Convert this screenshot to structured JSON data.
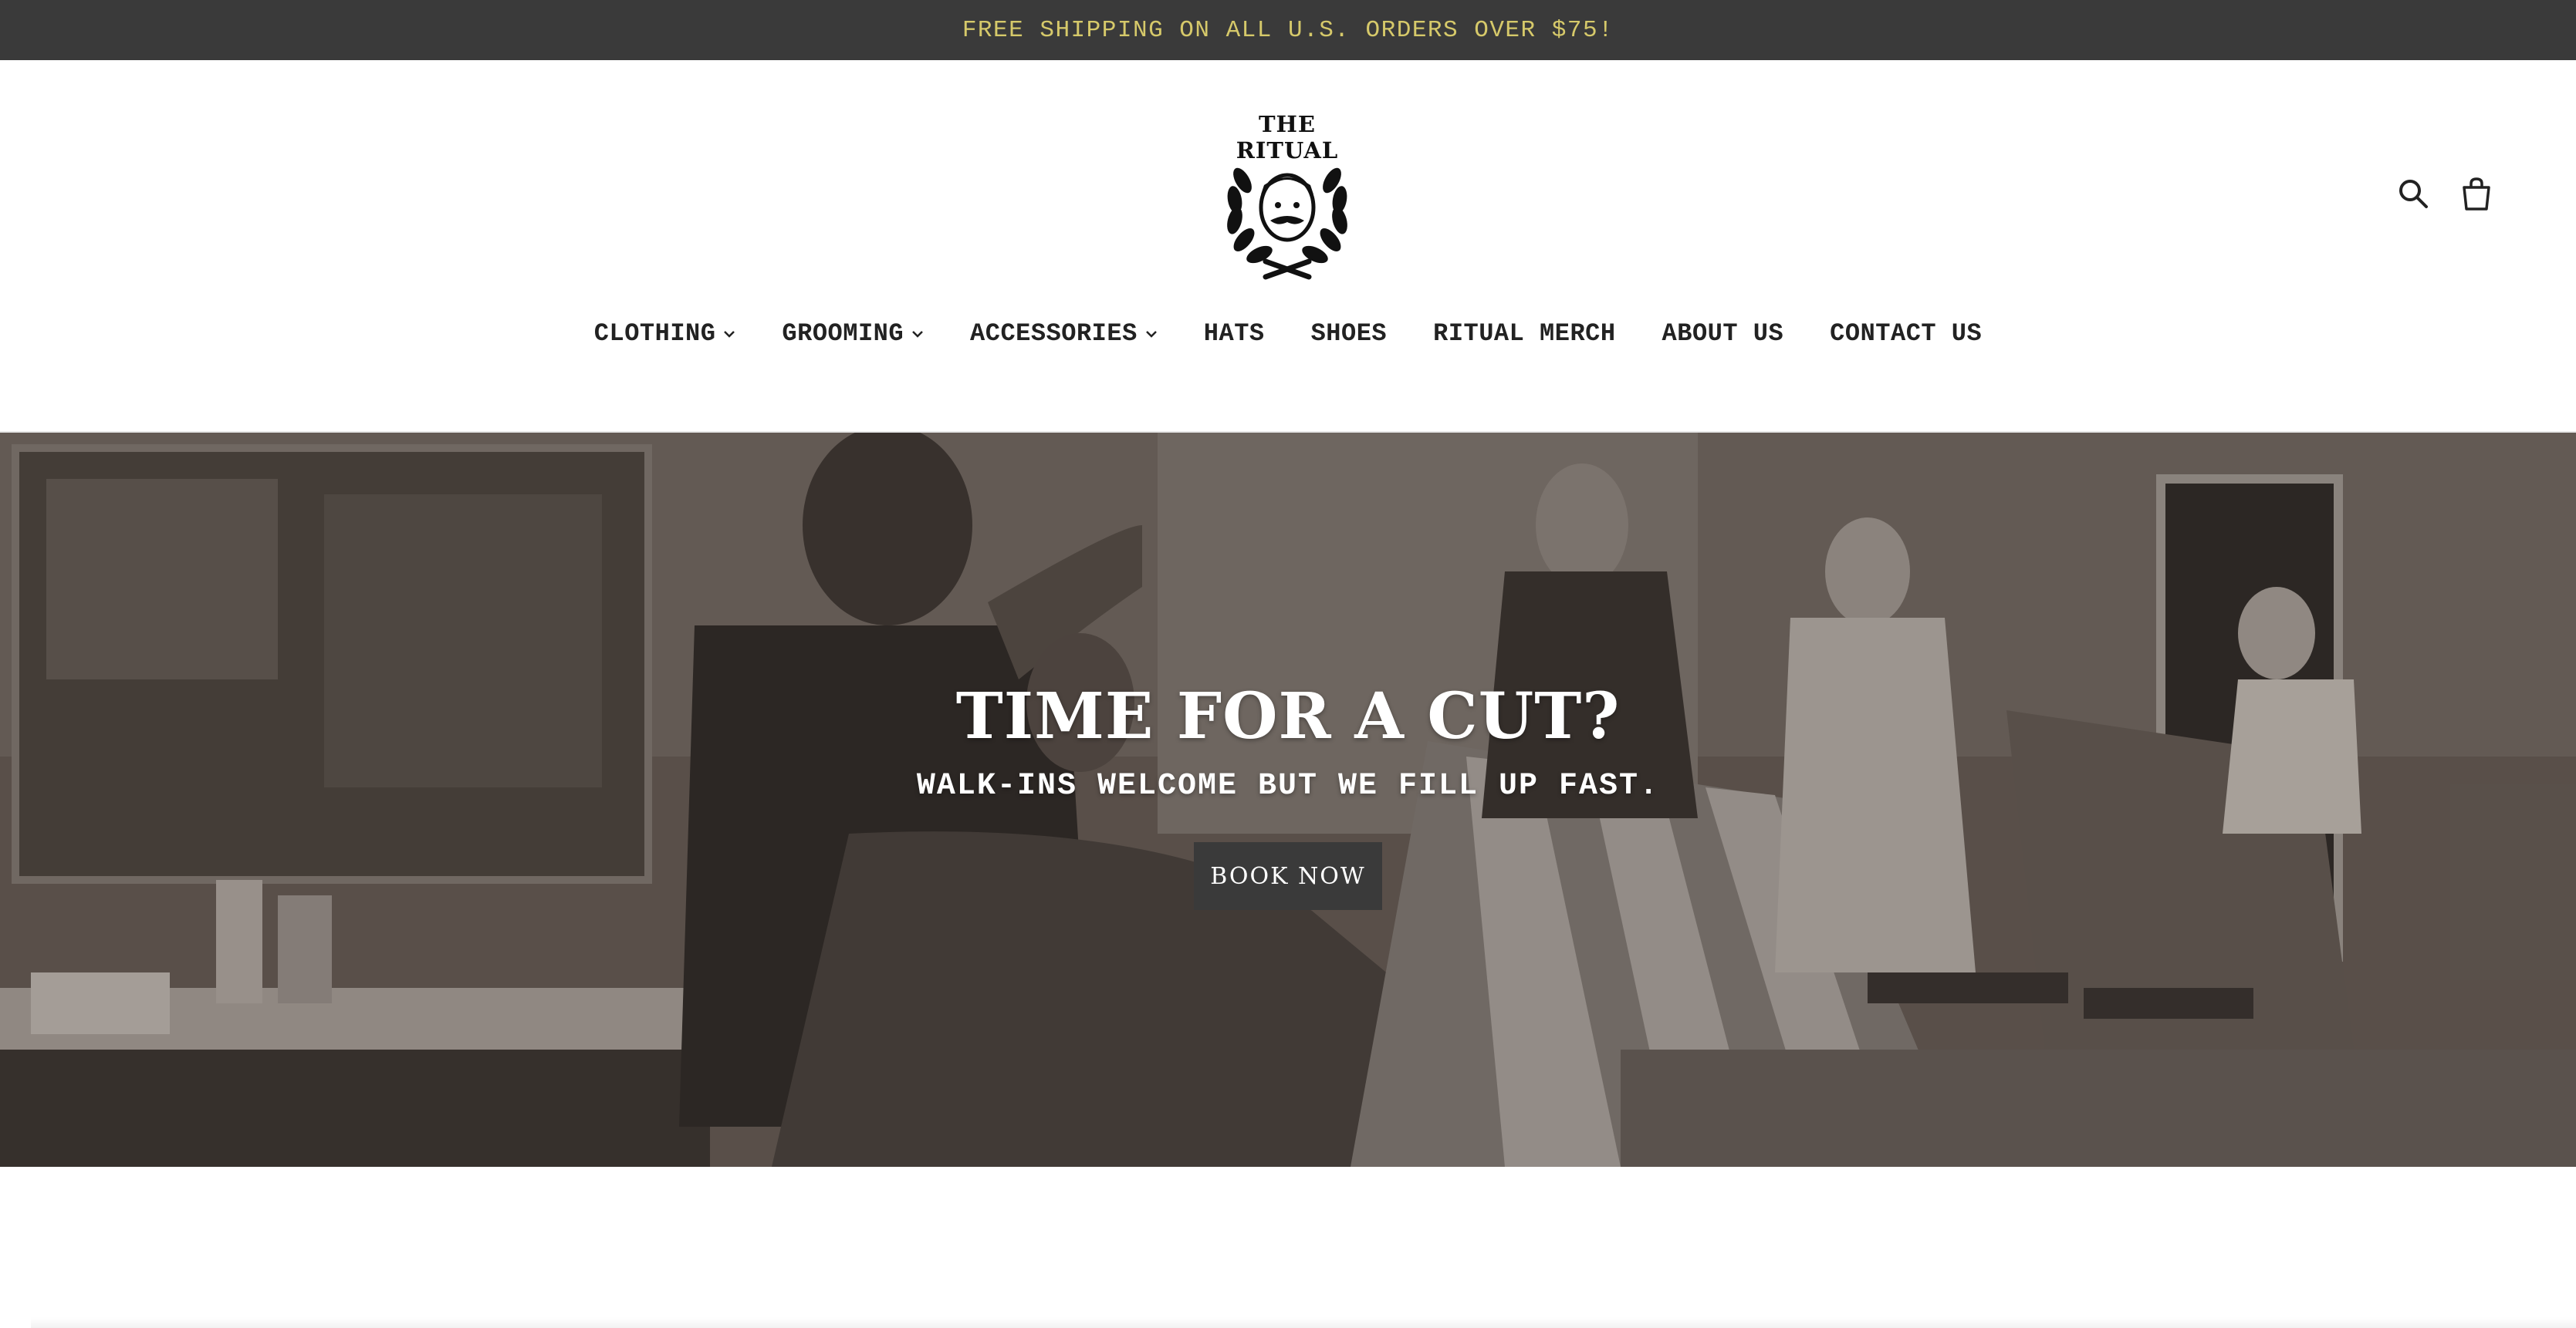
{
  "announcement": {
    "text": "FREE SHIPPING ON ALL U.S. ORDERS OVER $75!"
  },
  "logo": {
    "text": "THE RITUAL",
    "icon": "barber-laurel-logo"
  },
  "header_icons": {
    "search": "search-icon",
    "cart": "cart-icon"
  },
  "nav": {
    "items": [
      {
        "label": "CLOTHING",
        "has_dropdown": true
      },
      {
        "label": "GROOMING",
        "has_dropdown": true
      },
      {
        "label": "ACCESSORIES",
        "has_dropdown": true
      },
      {
        "label": "HATS",
        "has_dropdown": false
      },
      {
        "label": "SHOES",
        "has_dropdown": false
      },
      {
        "label": "RITUAL MERCH",
        "has_dropdown": false
      },
      {
        "label": "ABOUT US",
        "has_dropdown": false
      },
      {
        "label": "CONTACT US",
        "has_dropdown": false
      }
    ]
  },
  "hero": {
    "title": "TIME FOR A CUT?",
    "subtitle": "WALK-INS WELCOME BUT WE FILL UP FAST.",
    "button_label": "BOOK NOW"
  },
  "colors": {
    "announcement_bg": "#3a3a3a",
    "announcement_text": "#d6c96a",
    "button_bg": "#3a3a3a"
  }
}
